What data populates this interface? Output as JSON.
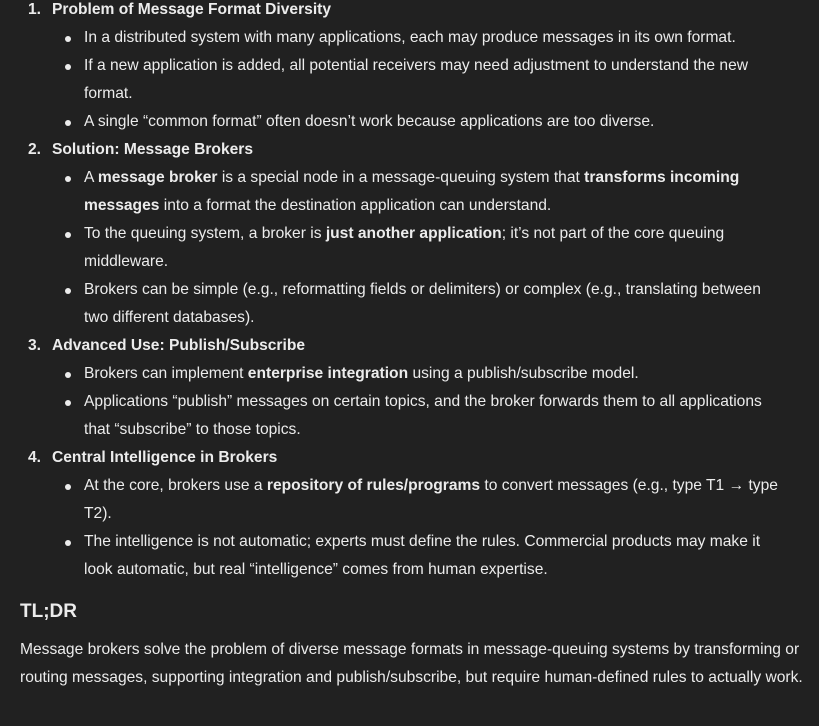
{
  "sections": [
    {
      "number": "1.",
      "title": "Problem of Message Format Diversity",
      "bullets": [
        [
          {
            "text": "In a distributed system with many applications, each may produce messages in its own format.",
            "bold": false
          }
        ],
        [
          {
            "text": "If a new application is added, all potential receivers may need adjustment to understand the new format.",
            "bold": false
          }
        ],
        [
          {
            "text": "A single “common format” often doesn’t work because applications are too diverse.",
            "bold": false
          }
        ]
      ]
    },
    {
      "number": "2.",
      "title": "Solution: Message Brokers",
      "bullets": [
        [
          {
            "text": "A ",
            "bold": false
          },
          {
            "text": "message broker",
            "bold": true
          },
          {
            "text": " is a special node in a message-queuing system that ",
            "bold": false
          },
          {
            "text": "transforms incoming messages",
            "bold": true
          },
          {
            "text": " into a format the destination application can understand.",
            "bold": false
          }
        ],
        [
          {
            "text": "To the queuing system, a broker is ",
            "bold": false
          },
          {
            "text": "just another application",
            "bold": true
          },
          {
            "text": "; it’s not part of the core queuing middleware.",
            "bold": false
          }
        ],
        [
          {
            "text": "Brokers can be simple (e.g., reformatting fields or delimiters) or complex (e.g., translating between two different databases).",
            "bold": false
          }
        ]
      ]
    },
    {
      "number": "3.",
      "title": "Advanced Use: Publish/Subscribe",
      "bullets": [
        [
          {
            "text": "Brokers can implement ",
            "bold": false
          },
          {
            "text": "enterprise integration",
            "bold": true
          },
          {
            "text": " using a publish/subscribe model.",
            "bold": false
          }
        ],
        [
          {
            "text": "Applications “publish” messages on certain topics, and the broker forwards them to all applications that “subscribe” to those topics.",
            "bold": false
          }
        ]
      ]
    },
    {
      "number": "4.",
      "title": "Central Intelligence in Brokers",
      "bullets": [
        [
          {
            "text": "At the core, brokers use a ",
            "bold": false
          },
          {
            "text": "repository of rules/programs",
            "bold": true
          },
          {
            "text": " to convert messages (e.g., type T1 → type T2).",
            "bold": false
          }
        ],
        [
          {
            "text": "The intelligence is not automatic; experts must define the rules. Commercial products may make it look automatic, but real “intelligence” comes from human expertise.",
            "bold": false
          }
        ]
      ]
    }
  ],
  "tldr": {
    "heading": "TL;DR",
    "text": "Message brokers solve the problem of diverse message formats in message-queuing systems by transforming or routing messages, supporting integration and publish/subscribe, but require human-defined rules to actually work."
  }
}
